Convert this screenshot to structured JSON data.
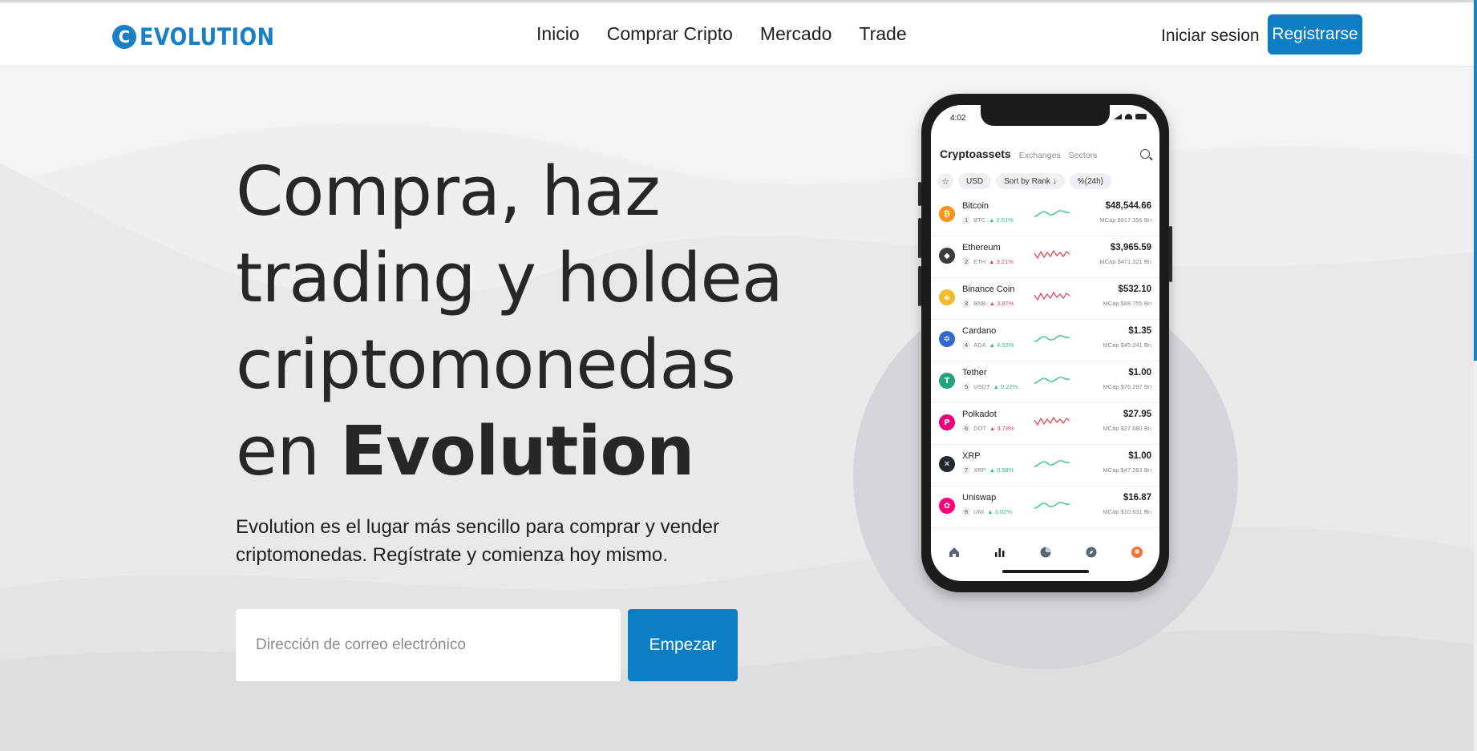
{
  "brand": {
    "name": "EVOLUTION",
    "mark": "C",
    "accent": "#0d7ec4"
  },
  "nav": {
    "links": [
      {
        "label": "Inicio"
      },
      {
        "label": "Comprar Cripto"
      },
      {
        "label": "Mercado"
      },
      {
        "label": "Trade"
      }
    ],
    "login": "Iniciar sesion",
    "register": "Registrarse"
  },
  "hero": {
    "headline_lines": [
      "Compra, haz",
      "trading y holdea",
      "criptomonedas"
    ],
    "headline_prefix": "en",
    "headline_brand": "Evolution",
    "subtext": "Evolution es el lugar más sencillo para comprar y vender criptomonedas. Regístrate y comienza hoy mismo.",
    "email_placeholder": "Dirección de correo electrónico",
    "cta": "Empezar"
  },
  "phone": {
    "time": "4:02",
    "tabs": [
      "Cryptoassets",
      "Exchanges",
      "Sectors"
    ],
    "filters": [
      "USD",
      "Sort by Rank ↓",
      "%(24h)"
    ],
    "star": "☆",
    "coins": [
      {
        "name": "Bitcoin",
        "rank": "1",
        "symbol": "BTC",
        "change": "▲ 2.51%",
        "trend": "up",
        "price": "$48,544.66",
        "mcap": "MCap $917.356 Bn",
        "icon": "bitcoin-icon",
        "glyph": "₿",
        "color": "#f7931a"
      },
      {
        "name": "Ethereum",
        "rank": "2",
        "symbol": "ETH",
        "change": "▲ 3.21%",
        "trend": "down",
        "price": "$3,965.59",
        "mcap": "MCap $471.321 Bn",
        "icon": "ethereum-icon",
        "glyph": "◆",
        "color": "#3c3c3d"
      },
      {
        "name": "Binance Coin",
        "rank": "3",
        "symbol": "BNB",
        "change": "▲ 3.87%",
        "trend": "down",
        "price": "$532.10",
        "mcap": "MCap $88.755 Bn",
        "icon": "binance-coin-icon",
        "glyph": "◈",
        "color": "#f3ba2f"
      },
      {
        "name": "Cardano",
        "rank": "4",
        "symbol": "ADA",
        "change": "▲ 4.52%",
        "trend": "up",
        "price": "$1.35",
        "mcap": "MCap $45.041 Bn",
        "icon": "cardano-icon",
        "glyph": "✲",
        "color": "#3468d1"
      },
      {
        "name": "Tether",
        "rank": "5",
        "symbol": "USDT",
        "change": "▲ 0.22%",
        "trend": "up",
        "price": "$1.00",
        "mcap": "MCap $76.297 Bn",
        "icon": "tether-icon",
        "glyph": "T",
        "color": "#26a17b"
      },
      {
        "name": "Polkadot",
        "rank": "6",
        "symbol": "DOT",
        "change": "▲ 3.78%",
        "trend": "down",
        "price": "$27.95",
        "mcap": "MCap $27.680 Bn",
        "icon": "polkadot-icon",
        "glyph": "P",
        "color": "#e6007a"
      },
      {
        "name": "XRP",
        "rank": "7",
        "symbol": "XRP",
        "change": "▲ 0.58%",
        "trend": "up",
        "price": "$1.00",
        "mcap": "MCap $47.283 Bn",
        "icon": "xrp-icon",
        "glyph": "✕",
        "color": "#23292f"
      },
      {
        "name": "Uniswap",
        "rank": "8",
        "symbol": "UNI",
        "change": "▲ 3.02%",
        "trend": "up",
        "price": "$16.87",
        "mcap": "MCap $10.631 Bn",
        "icon": "uniswap-icon",
        "glyph": "✿",
        "color": "#ff007a"
      }
    ],
    "colors": {
      "up": "#2ebd85",
      "down": "#e8475a"
    },
    "bottom_nav": [
      "home-icon",
      "market-chart-icon",
      "portfolio-pie-icon",
      "explore-compass-icon",
      "profile-avatar-icon"
    ]
  }
}
